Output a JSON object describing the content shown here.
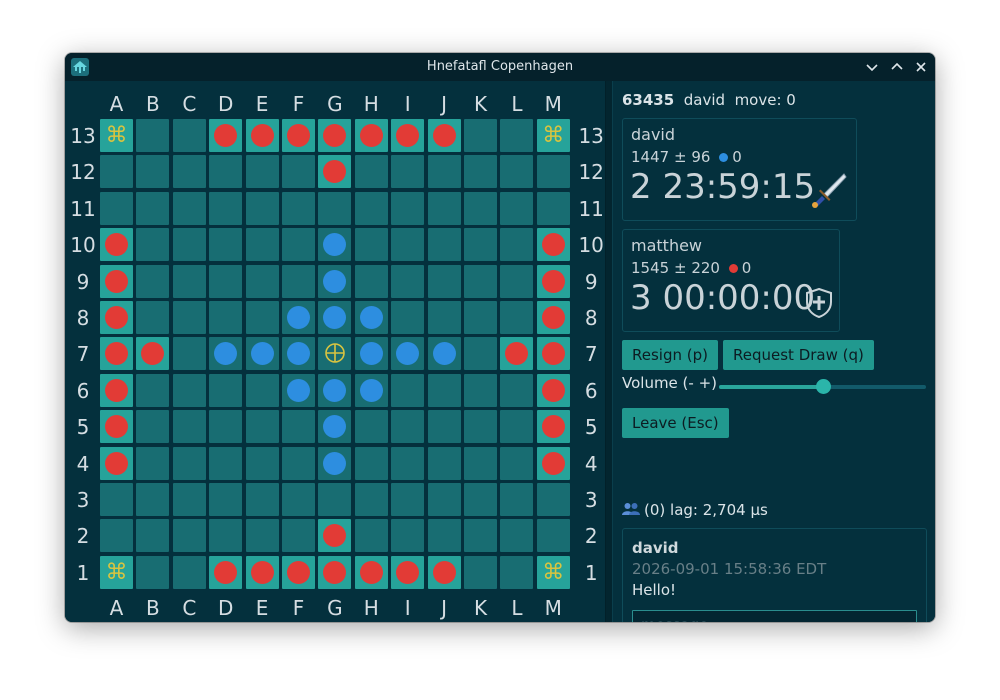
{
  "window": {
    "title": "Hnefatafl Copenhagen"
  },
  "board": {
    "columns": [
      "A",
      "B",
      "C",
      "D",
      "E",
      "F",
      "G",
      "H",
      "I",
      "J",
      "K",
      "L",
      "M"
    ],
    "rows": [
      "13",
      "12",
      "11",
      "10",
      "9",
      "8",
      "7",
      "6",
      "5",
      "4",
      "3",
      "2",
      "1"
    ],
    "grid": [
      "Kx.RRRRRRR.xK",
      "......R......",
      ".............",
      "R.....B.....R",
      "R.....B.....R",
      "R....BBB....R",
      "RR.BBBTBBB.RR",
      "R....BBB....R",
      "R.....B.....R",
      "R.....B.....R",
      ".............",
      "......R......",
      "Kx.RRRRRRR.xK"
    ],
    "legend": {
      "R": "red piece",
      "B": "blue piece",
      "K": "corner symbol ⌘",
      "T": "throne / king symbol ⨁",
      "x": "plain cell",
      ".": "empty cell"
    },
    "corner_symbol": "⌘",
    "colors": {
      "red": "#e23b36",
      "blue": "#2d8ee0",
      "cell": "#186d72",
      "tinted_cell": "#26a39a",
      "symbol": "#d8c440"
    }
  },
  "game": {
    "id": "63435",
    "user": "david",
    "move_label": "move: 0"
  },
  "players": [
    {
      "name": "david",
      "rating": "1447",
      "pm": "±",
      "deviation": "96",
      "captures": "0",
      "dot_color": "#2d8ee0",
      "clock": "2 23:59:15",
      "role_icon": "dagger-icon"
    },
    {
      "name": "matthew",
      "rating": "1545",
      "pm": "±",
      "deviation": "220",
      "captures": "0",
      "dot_color": "#e23b36",
      "clock": "3 00:00:00",
      "role_icon": "shield-icon"
    }
  ],
  "buttons": {
    "resign": "Resign (p)",
    "request_draw": "Request Draw (q)",
    "leave": "Leave (Esc)"
  },
  "volume": {
    "label": "Volume (- +)",
    "level": 0.5
  },
  "status": {
    "spectators": "(0)",
    "lag": "lag: 2,704 μs"
  },
  "chat": {
    "user": "david",
    "timestamp": "2026-09-01 15:58:36 EDT",
    "message": "Hello!",
    "placeholder": "message..."
  }
}
